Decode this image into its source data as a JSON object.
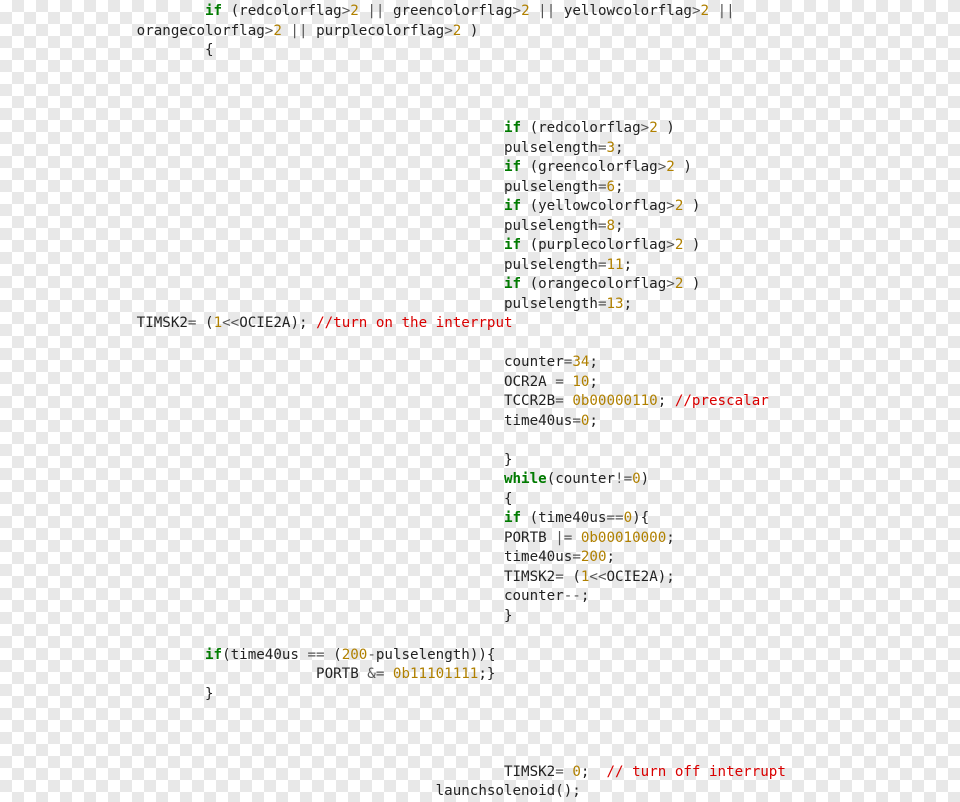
{
  "code": {
    "l01": {
      "kw": "if",
      "a": "(redcolorflag",
      "op1": ">",
      "n1": "2",
      "or1": " || ",
      "b": "greencolorflag",
      "op2": ">",
      "n2": "2",
      "or2": " || ",
      "c": "yellowcolorflag",
      "op3": ">",
      "n3": "2",
      "or3": " || "
    },
    "l02": {
      "a": "orangecolorflag",
      "op1": ">",
      "n1": "2",
      "or1": " || ",
      "b": "purplecolorflag",
      "op2": ">",
      "n2": "2",
      "tail": " )"
    },
    "l03": {
      "brace": "{"
    },
    "l07": {
      "kw": "if",
      "a": " (redcolorflag",
      "op": ">",
      "n": "2",
      "tail": " )"
    },
    "l08": {
      "id": "pulselength",
      "eq": "=",
      "n": "3",
      "semi": ";"
    },
    "l09": {
      "kw": "if",
      "a": " (greencolorflag",
      "op": ">",
      "n": "2",
      "tail": " )"
    },
    "l10": {
      "id": "pulselength",
      "eq": "=",
      "n": "6",
      "semi": ";"
    },
    "l11": {
      "kw": "if",
      "a": " (yellowcolorflag",
      "op": ">",
      "n": "2",
      "tail": " )"
    },
    "l12": {
      "id": "pulselength",
      "eq": "=",
      "n": "8",
      "semi": ";"
    },
    "l13": {
      "kw": "if",
      "a": " (purplecolorflag",
      "op": ">",
      "n": "2",
      "tail": " )"
    },
    "l14": {
      "id": "pulselength",
      "eq": "=",
      "n": "11",
      "semi": ";"
    },
    "l15": {
      "kw": "if",
      "a": " (orangecolorflag",
      "op": ">",
      "n": "2",
      "tail": " )"
    },
    "l16": {
      "id": "pulselength",
      "eq": "=",
      "n": "13",
      "semi": ";"
    },
    "l17": {
      "a": "TIMSK2",
      "eq": "= ",
      "b": "(",
      "n1": "1",
      "sh": "<<",
      "c": "OCIE2A); ",
      "cmt": "//turn on the interrput"
    },
    "l19": {
      "id": "counter",
      "eq": "=",
      "n": "34",
      "semi": ";"
    },
    "l20": {
      "a": "OCR2A ",
      "eq": "= ",
      "n": "10",
      "semi": ";"
    },
    "l21": {
      "a": "TCCR2B",
      "eq": "= ",
      "n": "0b00000110",
      "semi": "; ",
      "cmt": "//prescalar"
    },
    "l22": {
      "id": "time40us",
      "eq": "=",
      "n": "0",
      "semi": ";"
    },
    "l24": {
      "brace": "}"
    },
    "l25": {
      "kw": "while",
      "a": "(counter",
      "ne": "!=",
      "n": "0",
      "tail": ")"
    },
    "l26": {
      "brace": "{"
    },
    "l27": {
      "kw": "if",
      "a": " (time40us",
      "eqeq": "==",
      "n": "0",
      "tail": "){"
    },
    "l28": {
      "a": "PORTB ",
      "or": "|= ",
      "n": "0b00010000",
      "semi": ";"
    },
    "l29": {
      "id": "time40us",
      "eq": "=",
      "n": "200",
      "semi": ";"
    },
    "l30": {
      "a": "TIMSK2",
      "eq": "= ",
      "b": "(",
      "n1": "1",
      "sh": "<<",
      "c": "OCIE2A);"
    },
    "l31": {
      "id": "counter",
      "dec": "--",
      "semi": ";"
    },
    "l32": {
      "brace": "}"
    },
    "l34": {
      "kw": "if",
      "a": "(time40us ",
      "eqeq": "== ",
      "b": "(",
      "n1": "200",
      "minus": "-",
      "c": "pulselength)){"
    },
    "l35": {
      "a": "PORTB ",
      "and": "&= ",
      "n": "0b11101111",
      "tail": ";}"
    },
    "l36": {
      "brace": "}"
    },
    "l39": {
      "a": "TIMSK2",
      "eq": "= ",
      "n": "0",
      "semi": ";  ",
      "cmt": "// turn off interrupt"
    },
    "l40": {
      "a": "launchsolenoid();"
    }
  }
}
